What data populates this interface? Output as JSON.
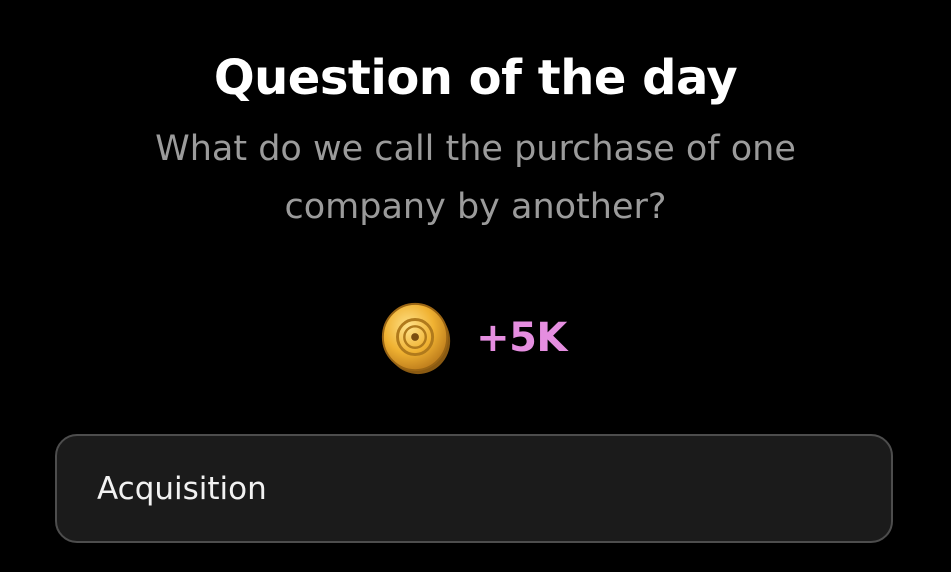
{
  "title": "Question of the day",
  "question": "What do we call the purchase of one company by another?",
  "reward": {
    "icon": "coin-icon",
    "amount": "+5K",
    "amount_color": "#e58ee0"
  },
  "answer": {
    "value": "Acquisition"
  },
  "colors": {
    "background": "#000000",
    "title": "#ffffff",
    "question": "#9b9b9b",
    "field_bg": "#1b1b1b",
    "field_border": "#4d4d4d"
  }
}
